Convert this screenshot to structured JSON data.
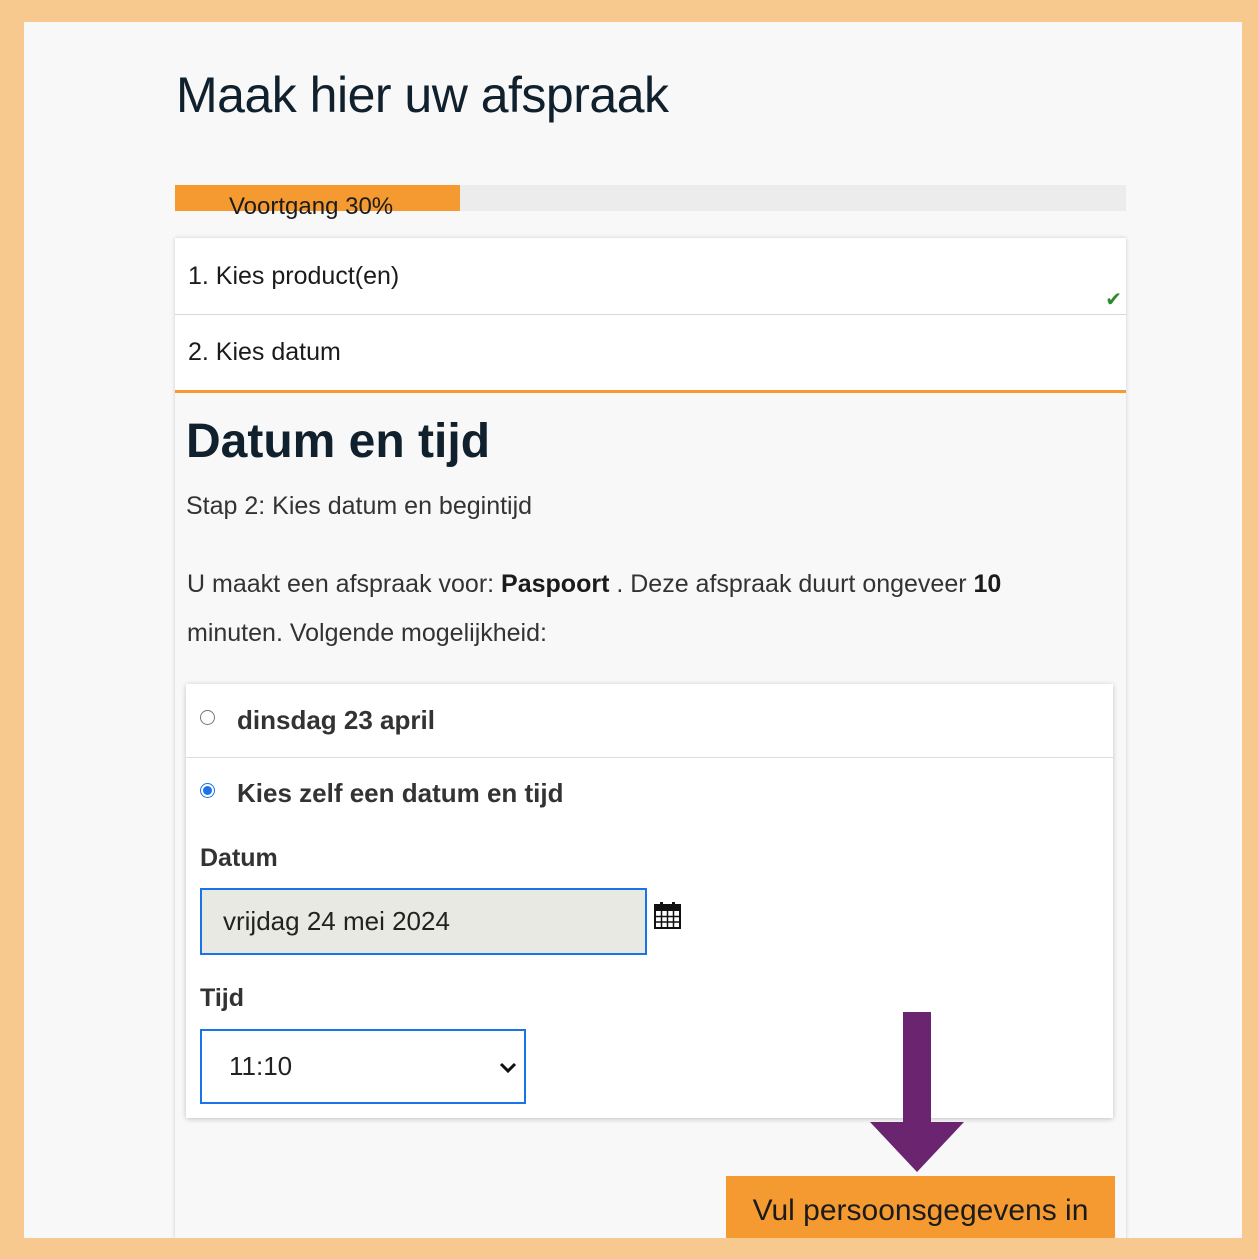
{
  "page_title": "Maak hier uw afspraak",
  "progress": {
    "label": "Voortgang 30%",
    "value": 30
  },
  "steps": [
    {
      "label": "1. Kies product(en)",
      "completed": true
    },
    {
      "label": "2. Kies datum",
      "active": true
    }
  ],
  "check_icon": "checkmark-icon",
  "section": {
    "title": "Datum en tijd",
    "substep": "Stap 2: Kies datum en begintijd",
    "intro_prefix": "U maakt een afspraak voor:",
    "product": "Paspoort",
    "intro_middle": ". Deze afspraak duurt ongeveer",
    "duration": "10",
    "intro_suffix": "minuten. Volgende mogelijkheid:"
  },
  "options": [
    {
      "label": "dinsdag 23 april",
      "selected": false
    },
    {
      "label": "Kies zelf een datum en tijd",
      "selected": true
    }
  ],
  "date_field": {
    "label": "Datum",
    "value": "vrijdag 24 mei 2024",
    "icon": "calendar-icon"
  },
  "time_field": {
    "label": "Tijd",
    "value": "11:10",
    "icon": "chevron-down-icon"
  },
  "next_button": {
    "label": "Vul persoonsgegevens in"
  },
  "colors": {
    "accent": "#f59a31",
    "frame": "#f8c98f",
    "focus": "#1a73e8",
    "arrow": "#6a2470",
    "check": "#2c8a2c"
  }
}
